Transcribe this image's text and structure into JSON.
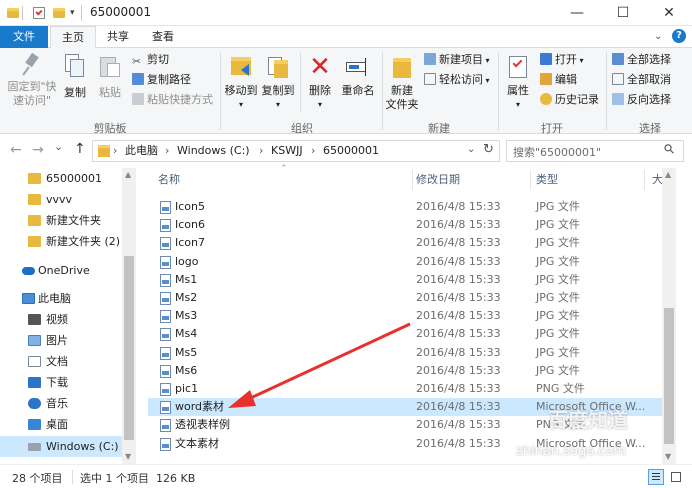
{
  "window": {
    "title": "65000001",
    "minimize": "—",
    "maximize": "☐",
    "close": "✕"
  },
  "tabs": {
    "file": "文件",
    "home": "主页",
    "share": "共享",
    "view": "查看"
  },
  "ribbon": {
    "clipboard": {
      "pin": "固定到\"快",
      "pin2": "速访问\"",
      "copy": "复制",
      "paste": "粘贴",
      "cut": "剪切",
      "copy_path": "复制路径",
      "paste_shortcut": "粘贴快捷方式",
      "label": "剪贴板"
    },
    "organize": {
      "move_to": "移动到",
      "copy_to": "复制到",
      "delete": "删除",
      "rename": "重命名",
      "label": "组织"
    },
    "new": {
      "new_folder": "新建",
      "new_folder2": "文件夹",
      "new_item": "新建项目",
      "easy_access": "轻松访问",
      "label": "新建"
    },
    "open": {
      "properties": "属性",
      "open": "打开",
      "edit": "编辑",
      "history": "历史记录",
      "label": "打开"
    },
    "select": {
      "select_all": "全部选择",
      "select_none": "全部取消",
      "invert": "反向选择",
      "label": "选择"
    }
  },
  "address": {
    "back": "←",
    "forward": "→",
    "recent": "⌄",
    "up": "↑",
    "crumbs": [
      "此电脑",
      "Windows (C:)",
      "KSWJJ",
      "65000001"
    ],
    "sep": "›",
    "refresh": "↻",
    "search_placeholder": "搜索\"65000001\"",
    "search_icon": "⚲"
  },
  "nav": {
    "items": [
      {
        "label": "65000001"
      },
      {
        "label": "vvvv"
      },
      {
        "label": "新建文件夹"
      },
      {
        "label": "新建文件夹 (2)"
      },
      {
        "label": "OneDrive"
      },
      {
        "label": "此电脑"
      },
      {
        "label": "视频"
      },
      {
        "label": "图片"
      },
      {
        "label": "文档"
      },
      {
        "label": "下载"
      },
      {
        "label": "音乐"
      },
      {
        "label": "桌面"
      },
      {
        "label": "Windows (C:)"
      }
    ]
  },
  "columns": {
    "name": "名称",
    "date": "修改日期",
    "type": "类型",
    "size": "大小"
  },
  "files": [
    {
      "name": "Icon5",
      "date": "2016/4/8 15:33",
      "type": "JPG 文件"
    },
    {
      "name": "Icon6",
      "date": "2016/4/8 15:33",
      "type": "JPG 文件"
    },
    {
      "name": "Icon7",
      "date": "2016/4/8 15:33",
      "type": "JPG 文件"
    },
    {
      "name": "logo",
      "date": "2016/4/8 15:33",
      "type": "JPG 文件"
    },
    {
      "name": "Ms1",
      "date": "2016/4/8 15:33",
      "type": "JPG 文件"
    },
    {
      "name": "Ms2",
      "date": "2016/4/8 15:33",
      "type": "JPG 文件"
    },
    {
      "name": "Ms3",
      "date": "2016/4/8 15:33",
      "type": "JPG 文件"
    },
    {
      "name": "Ms4",
      "date": "2016/4/8 15:33",
      "type": "JPG 文件"
    },
    {
      "name": "Ms5",
      "date": "2016/4/8 15:33",
      "type": "JPG 文件"
    },
    {
      "name": "Ms6",
      "date": "2016/4/8 15:33",
      "type": "JPG 文件"
    },
    {
      "name": "pic1",
      "date": "2016/4/8 15:33",
      "type": "PNG 文件"
    },
    {
      "name": "word素材",
      "date": "2016/4/8 15:33",
      "type": "Microsoft Office W..."
    },
    {
      "name": "透视表样例",
      "date": "2016/4/8 15:33",
      "type": "PNG 文件"
    },
    {
      "name": "文本素材",
      "date": "2016/4/8 15:33",
      "type": "Microsoft Office W..."
    }
  ],
  "status": {
    "count": "28 个项目",
    "selected": "选中 1 个项目  126 KB"
  },
  "watermark": {
    "line1": "百度知道",
    "line2": "zhinan.sogo.com"
  },
  "colors": {
    "accent": "#1979ca",
    "selection": "#cce8ff",
    "arrow": "#e8312f"
  }
}
